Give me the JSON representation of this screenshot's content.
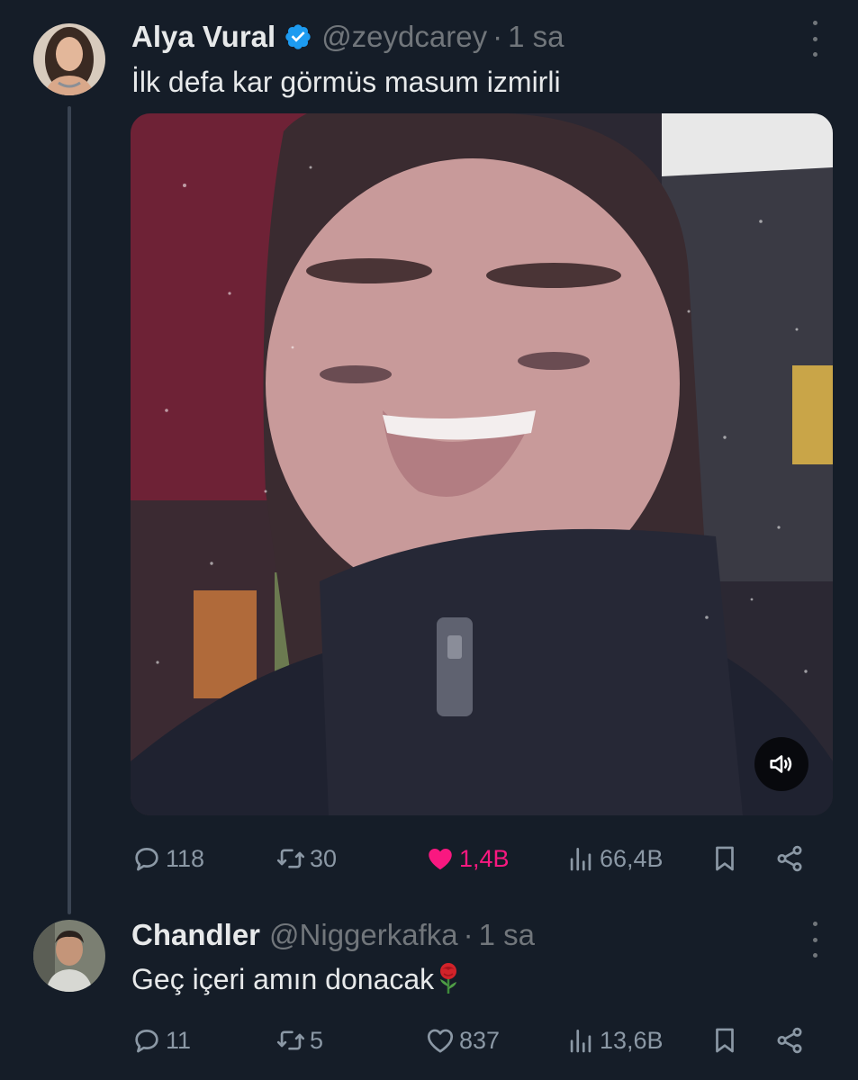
{
  "tweet": {
    "author_name": "Alya Vural",
    "handle": "@zeydcarey",
    "separator": "·",
    "time": "1 sa",
    "text": "İlk defa kar görmüs masum izmirli",
    "stats": {
      "replies": "118",
      "retweets": "30",
      "likes": "1,4B",
      "views": "66,4B"
    },
    "liked": true,
    "verified": true
  },
  "reply": {
    "author_name": "Chandler",
    "handle": "@Niggerkafka",
    "separator": "·",
    "time": "1 sa",
    "text": "Geç içeri amın donacak",
    "stats": {
      "replies": "11",
      "retweets": "5",
      "likes": "837",
      "views": "13,6B"
    },
    "liked": false
  },
  "icons": {
    "verified": "verified-badge-icon",
    "more": "more-dots-icon",
    "sound": "speaker-icon",
    "reply": "reply-icon",
    "retweet": "retweet-icon",
    "like": "heart-icon",
    "views": "views-icon",
    "bookmark": "bookmark-icon",
    "share": "share-icon",
    "emoji": "rose-icon"
  },
  "colors": {
    "background": "#151d28",
    "like": "#f91880",
    "verified": "#1d9bf0",
    "secondary": "#71767b"
  }
}
